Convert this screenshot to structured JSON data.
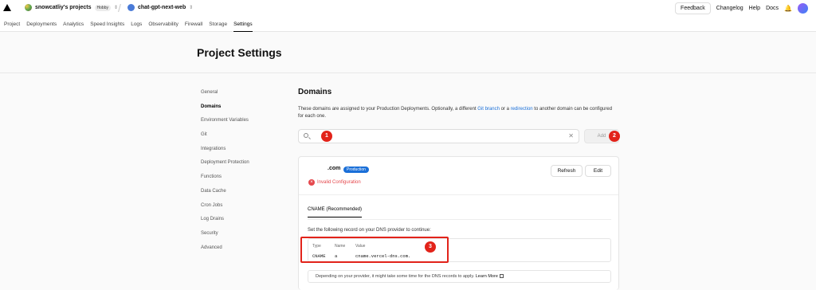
{
  "topbar": {
    "team_name": "snowcatliy's projects",
    "plan_badge": "Hobby",
    "project_name": "chat-gpt-next-web",
    "feedback_label": "Feedback",
    "changelog_label": "Changelog",
    "help_label": "Help",
    "docs_label": "Docs"
  },
  "tabs": [
    "Project",
    "Deployments",
    "Analytics",
    "Speed Insights",
    "Logs",
    "Observability",
    "Firewall",
    "Storage",
    "Settings"
  ],
  "page_title": "Project Settings",
  "sidebar": {
    "items": [
      "General",
      "Domains",
      "Environment Variables",
      "Git",
      "Integrations",
      "Deployment Protection",
      "Functions",
      "Data Cache",
      "Cron Jobs",
      "Log Drains",
      "Security",
      "Advanced"
    ],
    "active": "Domains"
  },
  "domains": {
    "heading": "Domains",
    "desc_part1": "These domains are assigned to your Production Deployments. Optionally, a different ",
    "desc_link1": "Git branch",
    "desc_part2": " or a ",
    "desc_link2": "redirection",
    "desc_part3": " to another domain can be configured for each one.",
    "add_label": "Add"
  },
  "markers": [
    "1",
    "2",
    "3"
  ],
  "card": {
    "domain": ".com",
    "badge": "Production",
    "status": "Invalid Configuration",
    "refresh_label": "Refresh",
    "edit_label": "Edit",
    "tab_label": "CNAME (Recommended)",
    "instruction": "Set the following record on your DNS provider to continue:",
    "record_headers": [
      "Type",
      "Name",
      "Value"
    ],
    "record_values": [
      "CNAME",
      "a",
      "cname.vercel-dns.com."
    ],
    "note_text": "Depending on your provider, it might take some time for the DNS records to apply.",
    "learn_more": "Learn More"
  },
  "colors": {
    "accent": "#1a6fd8",
    "error": "#e5484d",
    "marker": "#e2231a"
  }
}
